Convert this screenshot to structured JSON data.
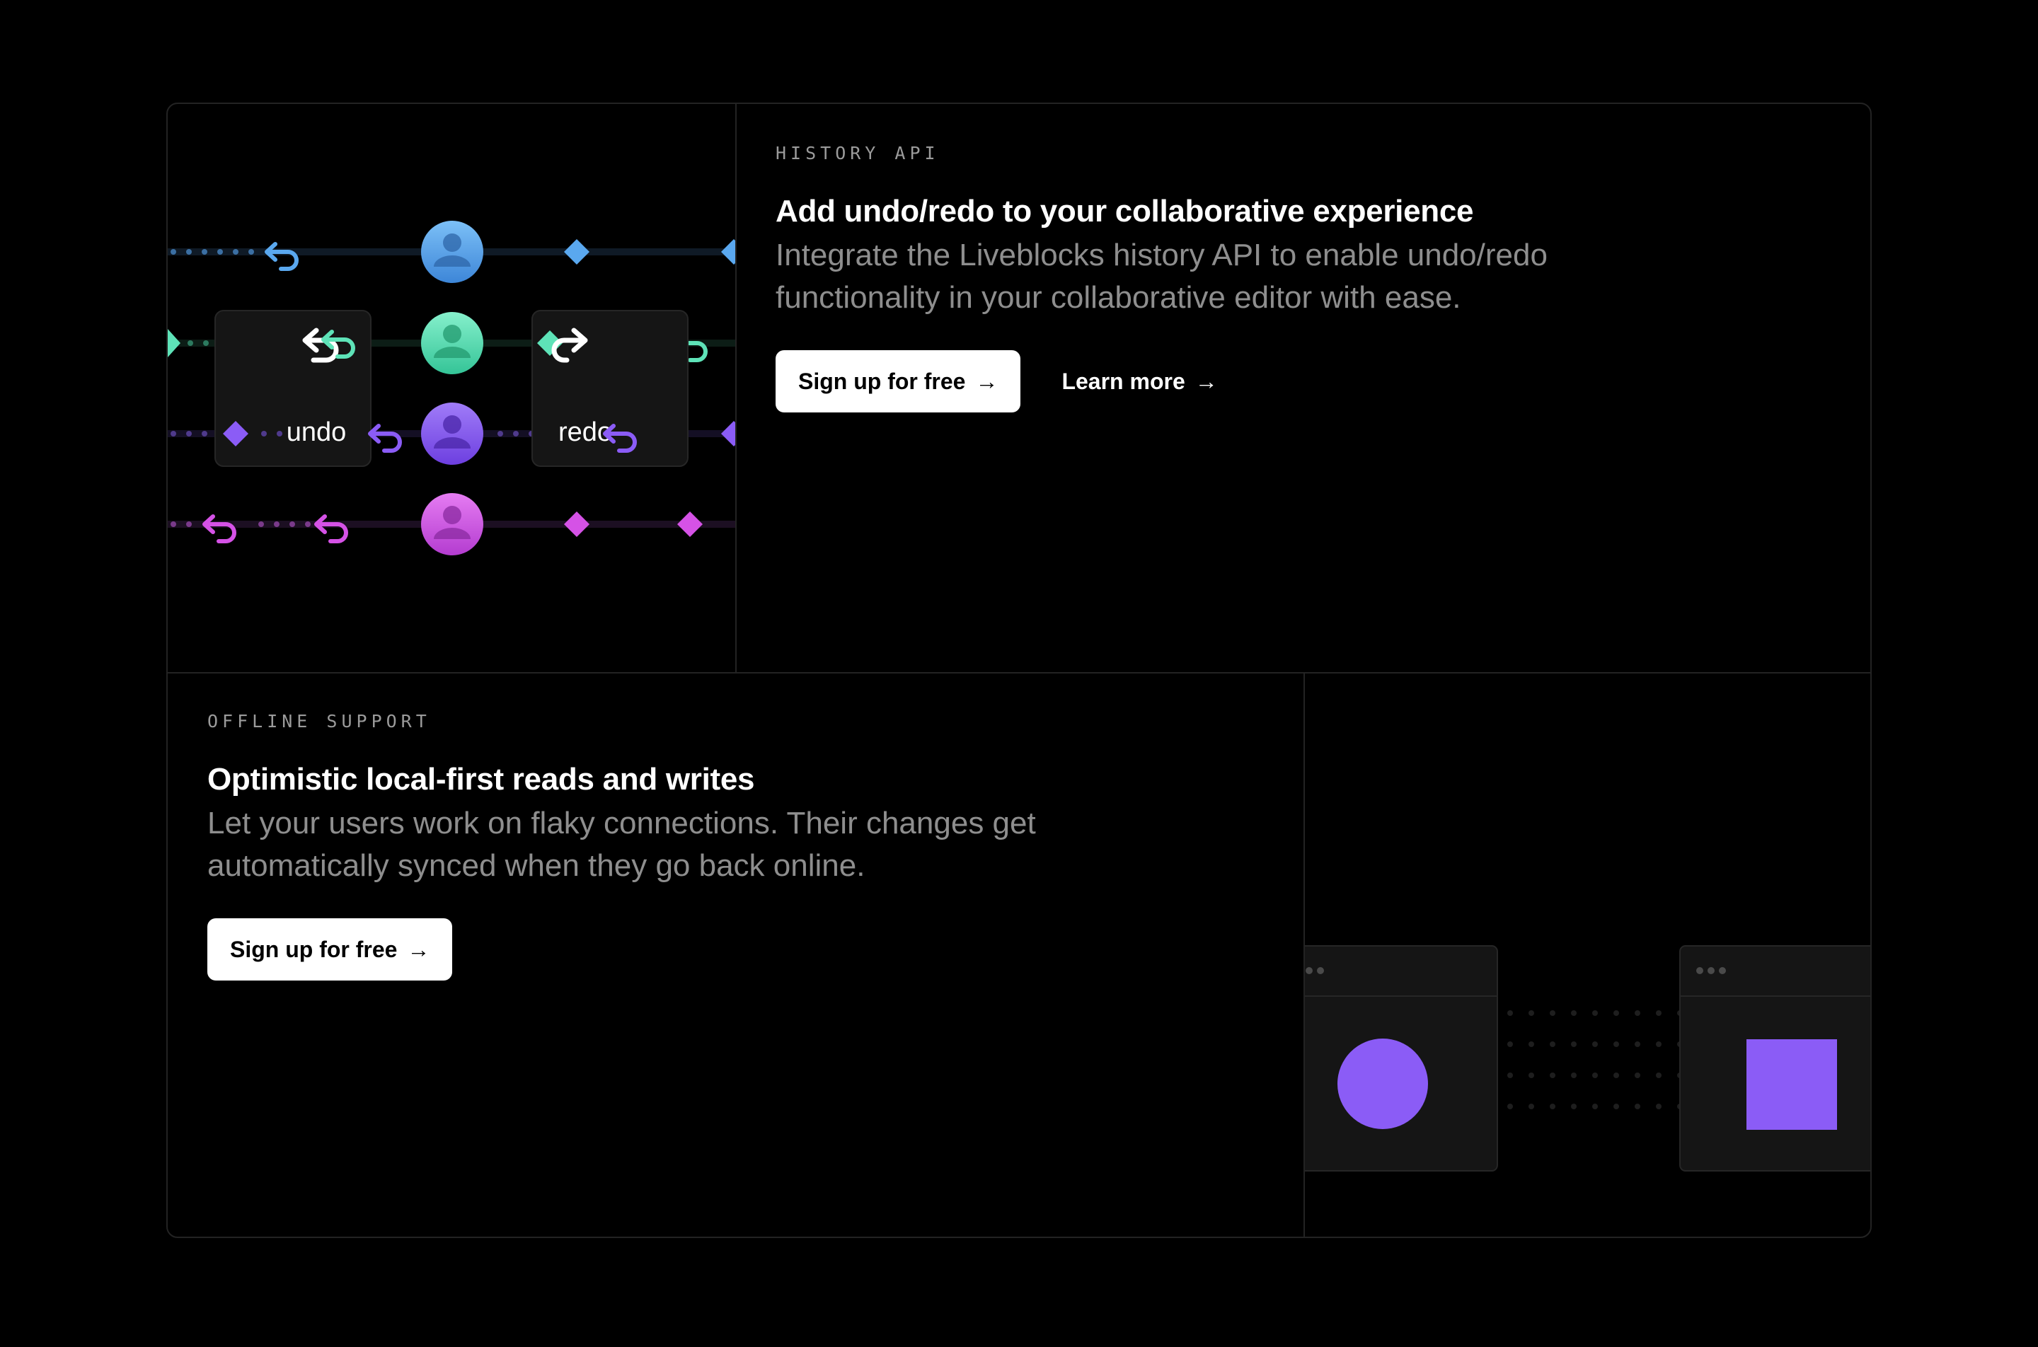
{
  "history": {
    "eyebrow": "HISTORY API",
    "title": "Add undo/redo to your collaborative experience",
    "description": "Integrate the Liveblocks history API to enable undo/redo functionality in your collaborative editor with ease.",
    "primary_cta": "Sign up for free",
    "secondary_cta": "Learn more",
    "arrow": "→",
    "undo_label": "undo",
    "redo_label": "redo",
    "colors": {
      "blue": "#5aa8ef",
      "teal": "#5ee3b8",
      "purple": "#8b5cf6",
      "magenta": "#d552e6"
    }
  },
  "offline": {
    "eyebrow": "OFFLINE SUPPORT",
    "title": "Optimistic local-first reads and writes",
    "description": "Let your users work on flaky connections. Their changes get automatically synced when they go back online.",
    "primary_cta": "Sign up for free",
    "arrow": "→",
    "colors": {
      "shape": "#8b5cf6",
      "window": "#151515"
    }
  }
}
